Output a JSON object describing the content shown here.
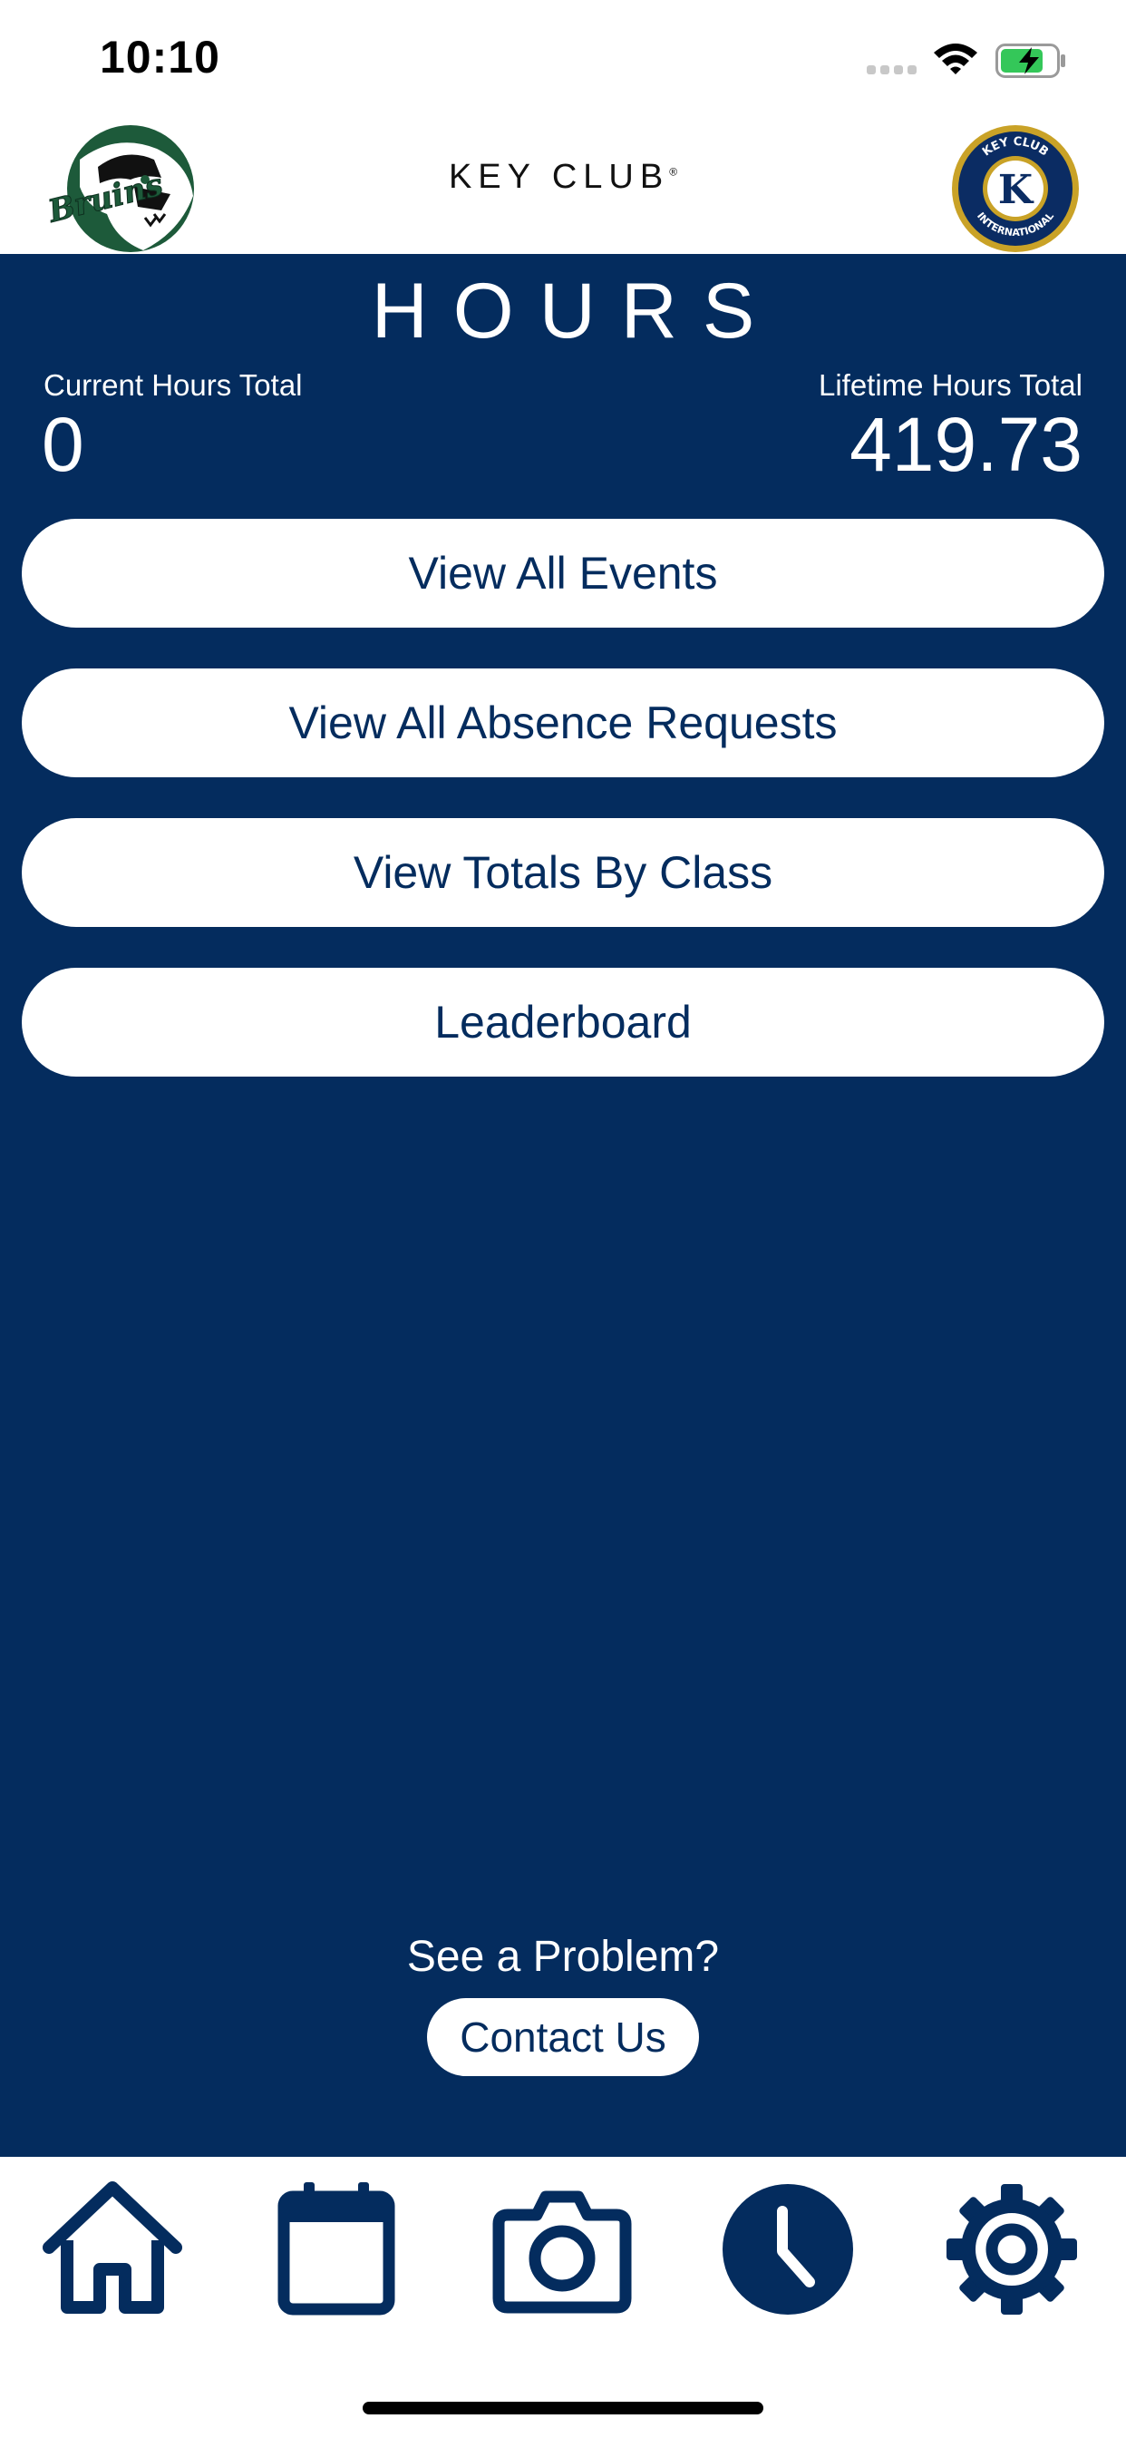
{
  "status_bar": {
    "time": "10:10",
    "icons": [
      "signal-icon",
      "wifi-icon",
      "battery-charging-icon"
    ]
  },
  "header": {
    "left_logo": "bruins-logo",
    "title_text": "KEY CLUB",
    "title_mark": "®",
    "right_logo": "key-club-international-seal",
    "seal_text": [
      "KEY CLUB",
      "INTERNATIONAL",
      "K"
    ]
  },
  "main": {
    "title": "HOURS",
    "current_hours_label": "Current Hours Total",
    "current_hours_value": "0",
    "lifetime_hours_label": "Lifetime Hours Total",
    "lifetime_hours_value": "419.73",
    "buttons": [
      {
        "label": "View All Events"
      },
      {
        "label": "View All Absence Requests"
      },
      {
        "label": "View Totals By Class"
      },
      {
        "label": "Leaderboard"
      }
    ],
    "problem_text": "See a Problem?",
    "contact_label": "Contact Us"
  },
  "tab_bar": {
    "items": [
      {
        "icon": "home-icon",
        "active": false
      },
      {
        "icon": "calendar-icon",
        "active": false
      },
      {
        "icon": "camera-icon",
        "active": false
      },
      {
        "icon": "clock-icon",
        "active": true
      },
      {
        "icon": "gear-icon",
        "active": false
      }
    ]
  },
  "colors": {
    "primary_navy": "#042c5e",
    "button_bg": "#ffffff",
    "logo_green": "#1d5a3a",
    "seal_gold": "#c9a227"
  }
}
